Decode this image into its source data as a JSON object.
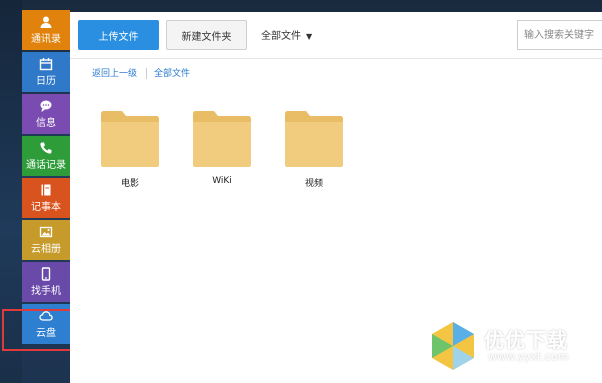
{
  "sidebar": {
    "items": [
      {
        "label": "通讯录",
        "icon": "contacts-icon",
        "color": "#e0820c"
      },
      {
        "label": "日历",
        "icon": "calendar-icon",
        "color": "#2f79c8"
      },
      {
        "label": "信息",
        "icon": "message-icon",
        "color": "#7a4bb0"
      },
      {
        "label": "通话记录",
        "icon": "phone-icon",
        "color": "#2f9c3a"
      },
      {
        "label": "记事本",
        "icon": "notebook-icon",
        "color": "#d9531e"
      },
      {
        "label": "云相册",
        "icon": "photo-icon",
        "color": "#c79a2c"
      },
      {
        "label": "找手机",
        "icon": "find-phone-icon",
        "color": "#6a4aa8"
      },
      {
        "label": "云盘",
        "icon": "cloud-icon",
        "color": "#2f7fd0"
      }
    ]
  },
  "toolbar": {
    "upload_label": "上传文件",
    "new_folder_label": "新建文件夹",
    "filter_label": "全部文件",
    "search_placeholder": "输入搜索关键字"
  },
  "breadcrumb": {
    "back_label": "返回上一级",
    "all_label": "全部文件"
  },
  "folders": [
    {
      "name": "电影"
    },
    {
      "name": "WiKi"
    },
    {
      "name": "视频"
    }
  ],
  "watermark": {
    "title": "优优下载",
    "url": "www.yyxt.com"
  },
  "colors": {
    "accent": "#2a8fe0",
    "folder": "#f0c777",
    "highlight": "#e23a3a"
  }
}
